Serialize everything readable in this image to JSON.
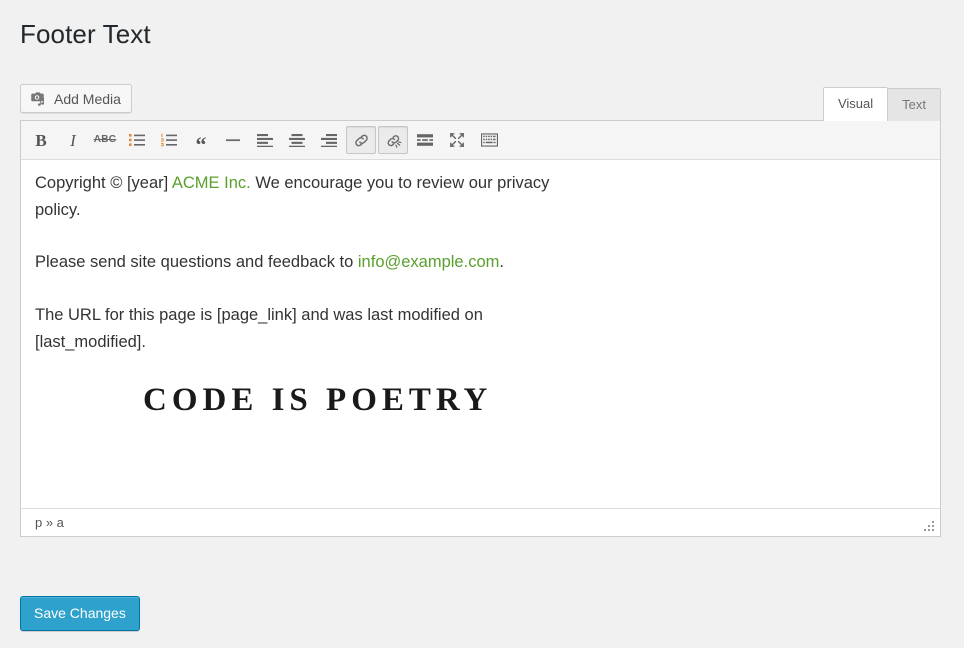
{
  "page": {
    "title": "Footer Text",
    "background_color": "#f1f1f1"
  },
  "media_button": {
    "label": "Add Media",
    "icon": "add-media-icon"
  },
  "tabs": [
    {
      "label": "Visual",
      "active": true
    },
    {
      "label": "Text",
      "active": false
    }
  ],
  "toolbar": {
    "buttons": [
      {
        "name": "bold-button",
        "icon": "bold-icon",
        "glyph": "B",
        "active": false
      },
      {
        "name": "italic-button",
        "icon": "italic-icon",
        "glyph": "I",
        "active": false
      },
      {
        "name": "strikethrough-button",
        "icon": "strikethrough-icon",
        "glyph": "ABC",
        "active": false
      },
      {
        "name": "bulleted-list-button",
        "icon": "bulleted-list-icon",
        "active": false
      },
      {
        "name": "numbered-list-button",
        "icon": "numbered-list-icon",
        "active": false
      },
      {
        "name": "blockquote-button",
        "icon": "blockquote-icon",
        "glyph": "“",
        "active": false
      },
      {
        "name": "horizontal-rule-button",
        "icon": "horizontal-rule-icon",
        "active": false
      },
      {
        "name": "align-left-button",
        "icon": "align-left-icon",
        "active": false
      },
      {
        "name": "align-center-button",
        "icon": "align-center-icon",
        "active": false
      },
      {
        "name": "align-right-button",
        "icon": "align-right-icon",
        "active": false
      },
      {
        "name": "insert-link-button",
        "icon": "link-icon",
        "active": true
      },
      {
        "name": "remove-link-button",
        "icon": "unlink-icon",
        "active": true
      },
      {
        "name": "insert-read-more-button",
        "icon": "read-more-icon",
        "active": false
      },
      {
        "name": "distraction-free-button",
        "icon": "fullscreen-icon",
        "active": false
      },
      {
        "name": "toolbar-toggle-button",
        "icon": "kitchen-sink-icon",
        "active": false
      }
    ]
  },
  "content": {
    "link_color": "#5aa02c",
    "paragraphs": [
      {
        "parts": [
          {
            "type": "text",
            "value": "Copyright © [year] "
          },
          {
            "type": "link",
            "value": "ACME Inc."
          },
          {
            "type": "text",
            "value": " We encourage you to review our privacy policy."
          }
        ]
      },
      {
        "parts": [
          {
            "type": "text",
            "value": "Please send site questions and feedback to "
          },
          {
            "type": "link",
            "value": "info@example.com"
          },
          {
            "type": "text",
            "value": "."
          }
        ]
      },
      {
        "parts": [
          {
            "type": "text",
            "value": "The URL for this page is [page_link] and was last modified on [last_modified]."
          }
        ]
      }
    ],
    "p1_prefix": "Copyright © [year] ",
    "p1_link": "ACME Inc.",
    "p1_suffix": " We encourage you to review our privacy policy.",
    "p2_prefix": "Please send site questions and feedback to ",
    "p2_link": "info@example.com",
    "p2_suffix": ".",
    "p3_text": "The URL for this page is [page_link] and was last modified on [last_modified].",
    "logo_text": "CODE IS POETRY"
  },
  "statusbar": {
    "element_path": "p » a"
  },
  "submit": {
    "save_label": "Save Changes",
    "accent_color": "#2ea2cc"
  }
}
